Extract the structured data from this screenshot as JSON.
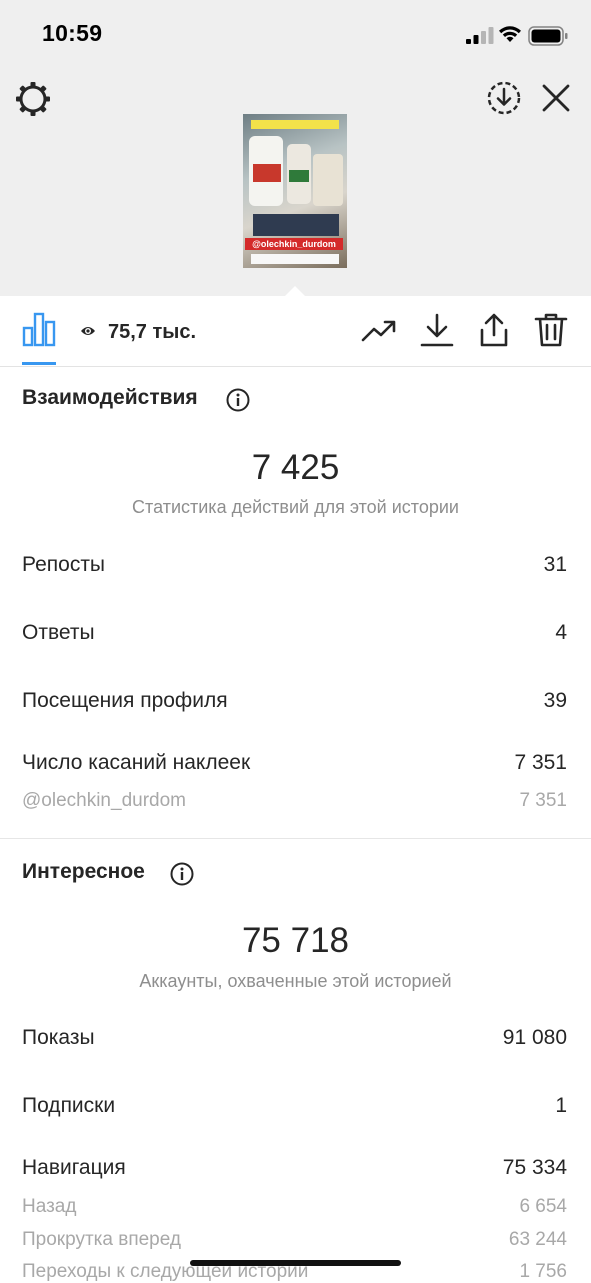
{
  "status_bar": {
    "time": "10:59"
  },
  "story_preview": {
    "overlay_handle": "@olechkin_durdom"
  },
  "toolbar": {
    "views": "75,7 тыс."
  },
  "interactions": {
    "title": "Взаимодействия",
    "total": "7 425",
    "subtitle": "Статистика действий для этой истории",
    "rows": [
      {
        "label": "Репосты",
        "value": "31"
      },
      {
        "label": "Ответы",
        "value": "4"
      },
      {
        "label": "Посещения профиля",
        "value": "39"
      },
      {
        "label": "Число касаний наклеек",
        "value": "7 351"
      }
    ],
    "sub_rows": [
      {
        "label": "@olechkin_durdom",
        "value": "7 351"
      }
    ]
  },
  "discovery": {
    "title": "Интересное",
    "total": "75 718",
    "subtitle": "Аккаунты, охваченные этой историей",
    "rows": [
      {
        "label": "Показы",
        "value": "91 080"
      },
      {
        "label": "Подписки",
        "value": "1"
      },
      {
        "label": "Навигация",
        "value": "75 334"
      }
    ],
    "sub_rows": [
      {
        "label": "Назад",
        "value": "6 654"
      },
      {
        "label": "Прокрутка вперед",
        "value": "63 244"
      },
      {
        "label": "Переходы к следующей истории",
        "value": "1 756"
      }
    ]
  },
  "colors": {
    "accent": "#3897f0",
    "text": "#262626",
    "muted": "#8e8e8e",
    "header_bg": "#efefef"
  },
  "icons": [
    "settings-gear-icon",
    "save-download-icon",
    "close-icon",
    "insights-bar-chart-icon",
    "eye-icon",
    "promote-trend-icon",
    "download-icon",
    "share-icon",
    "trash-icon",
    "info-icon"
  ]
}
